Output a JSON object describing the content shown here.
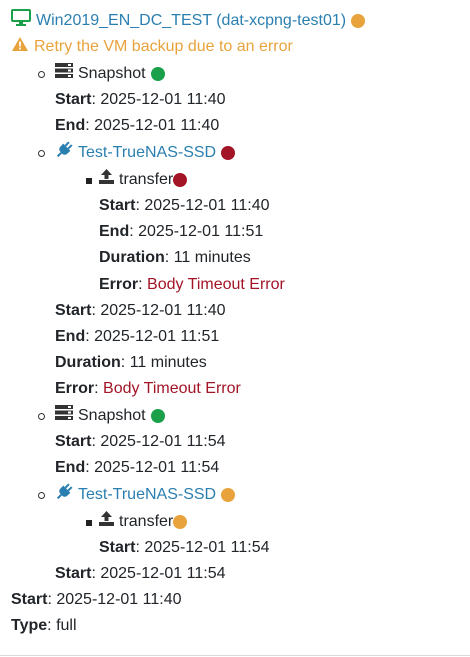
{
  "colors": {
    "link": "#2a7fb0",
    "warning": "#e8a33c",
    "success": "#1aa04a",
    "failure": "#a31526"
  },
  "vm": {
    "name": "Win2019_EN_DC_TEST (dat-xcpng-test01)",
    "icon": "desktop-icon",
    "status": "warning"
  },
  "warning": {
    "icon": "warning-triangle-icon",
    "text": "Retry the VM backup due to an error"
  },
  "labels": {
    "start": "Start",
    "end": "End",
    "duration": "Duration",
    "error": "Error",
    "type": "Type",
    "sep": ":"
  },
  "tasks": [
    {
      "kind": "snapshot",
      "icon": "server-icon",
      "title": "Snapshot",
      "status": "success",
      "start": "2025-12-01 11:40",
      "end": "2025-12-01 11:40"
    },
    {
      "kind": "remote",
      "icon": "plug-icon",
      "title": "Test-TrueNAS-SSD",
      "status": "failure",
      "transfer": {
        "icon": "upload-icon",
        "title": "transfer",
        "status": "failure",
        "start": "2025-12-01 11:40",
        "end": "2025-12-01 11:51",
        "duration": "11 minutes",
        "error": "Body Timeout Error"
      },
      "start": "2025-12-01 11:40",
      "end": "2025-12-01 11:51",
      "duration": "11 minutes",
      "error": "Body Timeout Error"
    },
    {
      "kind": "snapshot",
      "icon": "server-icon",
      "title": "Snapshot",
      "status": "success",
      "start": "2025-12-01 11:54",
      "end": "2025-12-01 11:54"
    },
    {
      "kind": "remote",
      "icon": "plug-icon",
      "title": "Test-TrueNAS-SSD",
      "status": "warning",
      "transfer": {
        "icon": "upload-icon",
        "title": "transfer",
        "status": "warning",
        "start": "2025-12-01 11:54"
      },
      "start": "2025-12-01 11:54"
    }
  ],
  "summary": {
    "start": "2025-12-01 11:40",
    "type": "full"
  }
}
